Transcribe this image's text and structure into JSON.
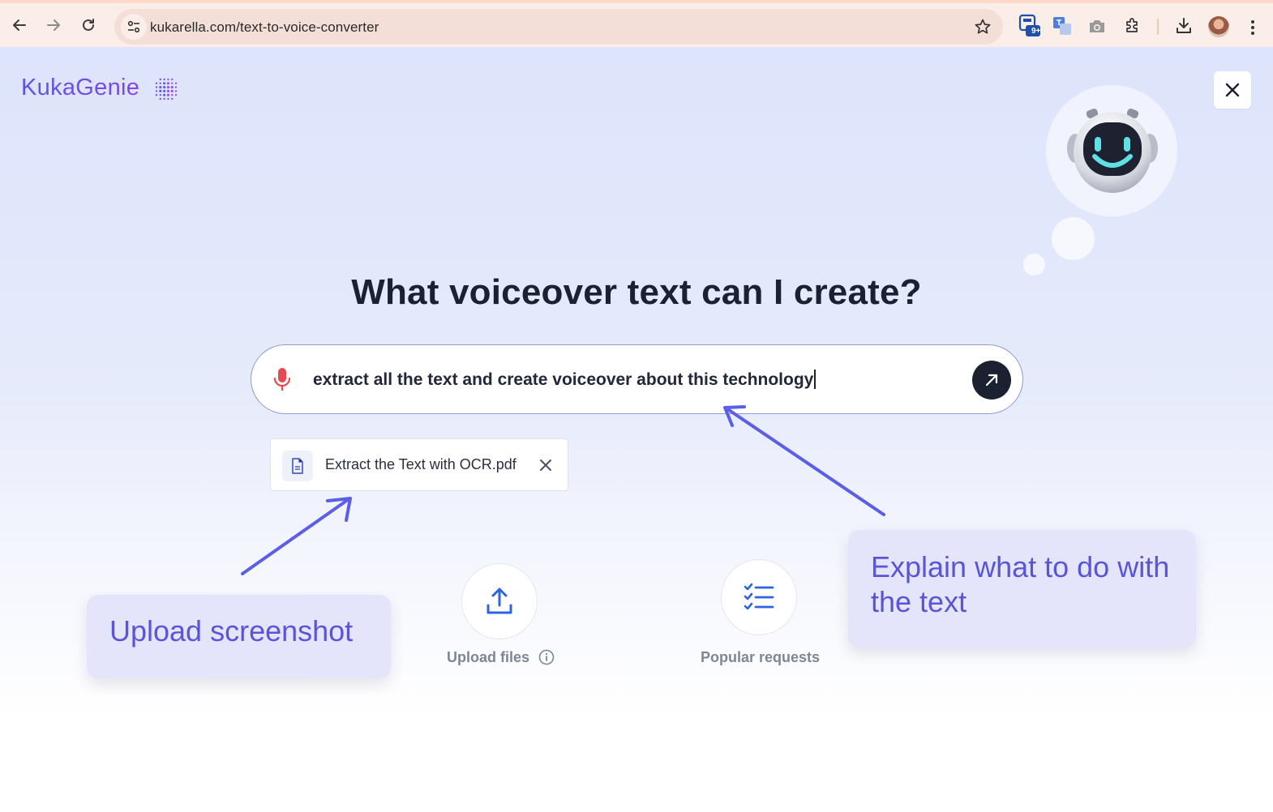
{
  "browser": {
    "url": "kukarella.com/text-to-voice-converter",
    "extension_badge": "9+"
  },
  "page": {
    "logo_text": "KukaGenie",
    "heading": "What voiceover text can I create?",
    "prompt": {
      "value": "extract all the text and create voiceover about this technology"
    },
    "attachment": {
      "file_name": "Extract the Text with OCR.pdf"
    },
    "actions": {
      "upload_label": "Upload files",
      "popular_label": "Popular requests"
    },
    "callouts": {
      "upload": "Upload screenshot",
      "explain": "Explain what to do with the text"
    }
  },
  "colors": {
    "accent": "#5a55d8",
    "arrow": "#5b5fe8",
    "mic": "#e5484d",
    "send_button": "#1b2130"
  }
}
